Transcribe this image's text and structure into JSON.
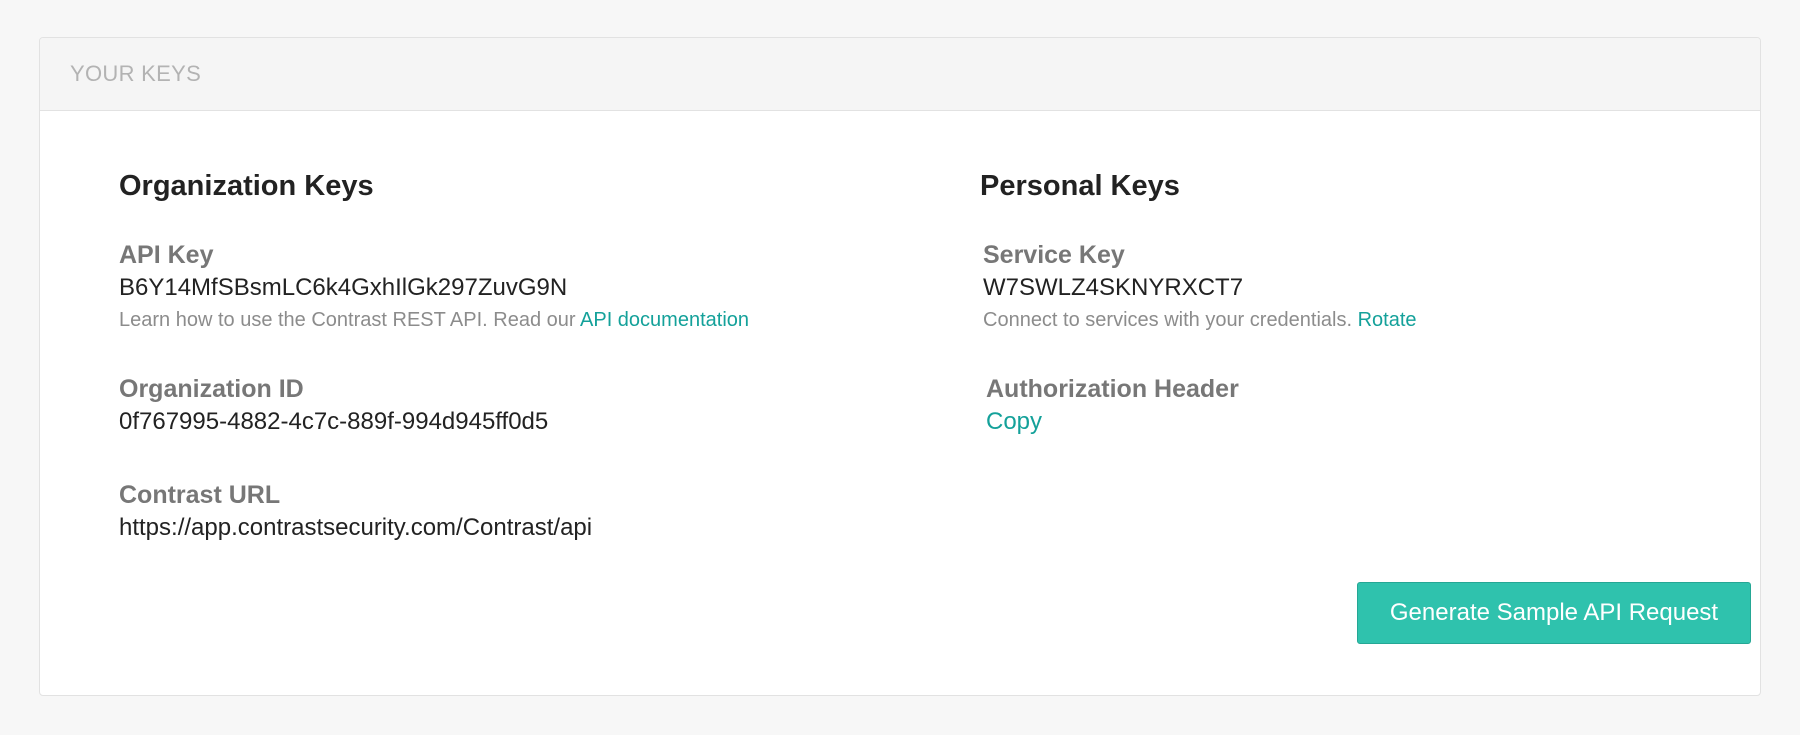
{
  "panel": {
    "title": "YOUR KEYS"
  },
  "organization": {
    "title": "Organization Keys",
    "api_key": {
      "label": "API Key",
      "value": "B6Y14MfSBsmLC6k4GxhIlGk297ZuvG9N",
      "help_text": "Learn how to use the Contrast REST API. Read our ",
      "help_link": "API documentation"
    },
    "org_id": {
      "label": "Organization ID",
      "value": "0f767995-4882-4c7c-889f-994d945ff0d5"
    },
    "contrast_url": {
      "label": "Contrast URL",
      "value": "https://app.contrastsecurity.com/Contrast/api"
    }
  },
  "personal": {
    "title": "Personal Keys",
    "service_key": {
      "label": "Service Key",
      "value": "W7SWLZ4SKNYRXCT7",
      "help_text": "Connect to services with your credentials. ",
      "help_link": "Rotate"
    },
    "auth_header": {
      "label": "Authorization Header",
      "copy_label": "Copy"
    }
  },
  "actions": {
    "generate_label": "Generate Sample API Request"
  },
  "colors": {
    "accent": "#14a19a",
    "button": "#2fc2ad"
  }
}
